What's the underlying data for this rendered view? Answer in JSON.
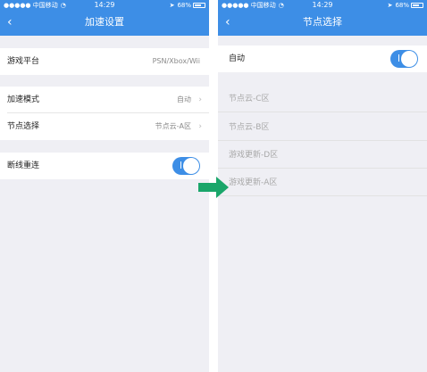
{
  "status_bar": {
    "carrier": "●●●●● 中国移动",
    "time": "14:29",
    "battery": "68%",
    "battery_level": 0.68
  },
  "left_screen": {
    "title": "加速设置",
    "rows": [
      {
        "label": "游戏平台",
        "value": "PSN/Xbox/Wii"
      },
      {
        "label": "加速模式",
        "value": "自动"
      },
      {
        "label": "节点选择",
        "value": "节点云-A区"
      },
      {
        "label": "断线重连",
        "toggle": true
      }
    ]
  },
  "right_screen": {
    "title": "节点选择",
    "auto_label": "自动",
    "auto_toggle": true,
    "nodes": [
      "节点云-C区",
      "节点云-B区",
      "游戏更新-D区",
      "游戏更新-A区"
    ]
  },
  "colors": {
    "header": "#3d8ee6",
    "arrow": "#1aa66a",
    "toggle_on": "#3d8ee6"
  },
  "icons": {
    "back": "chevron-left-icon",
    "chevron": "chevron-right-icon",
    "arrow": "right-arrow-icon"
  }
}
